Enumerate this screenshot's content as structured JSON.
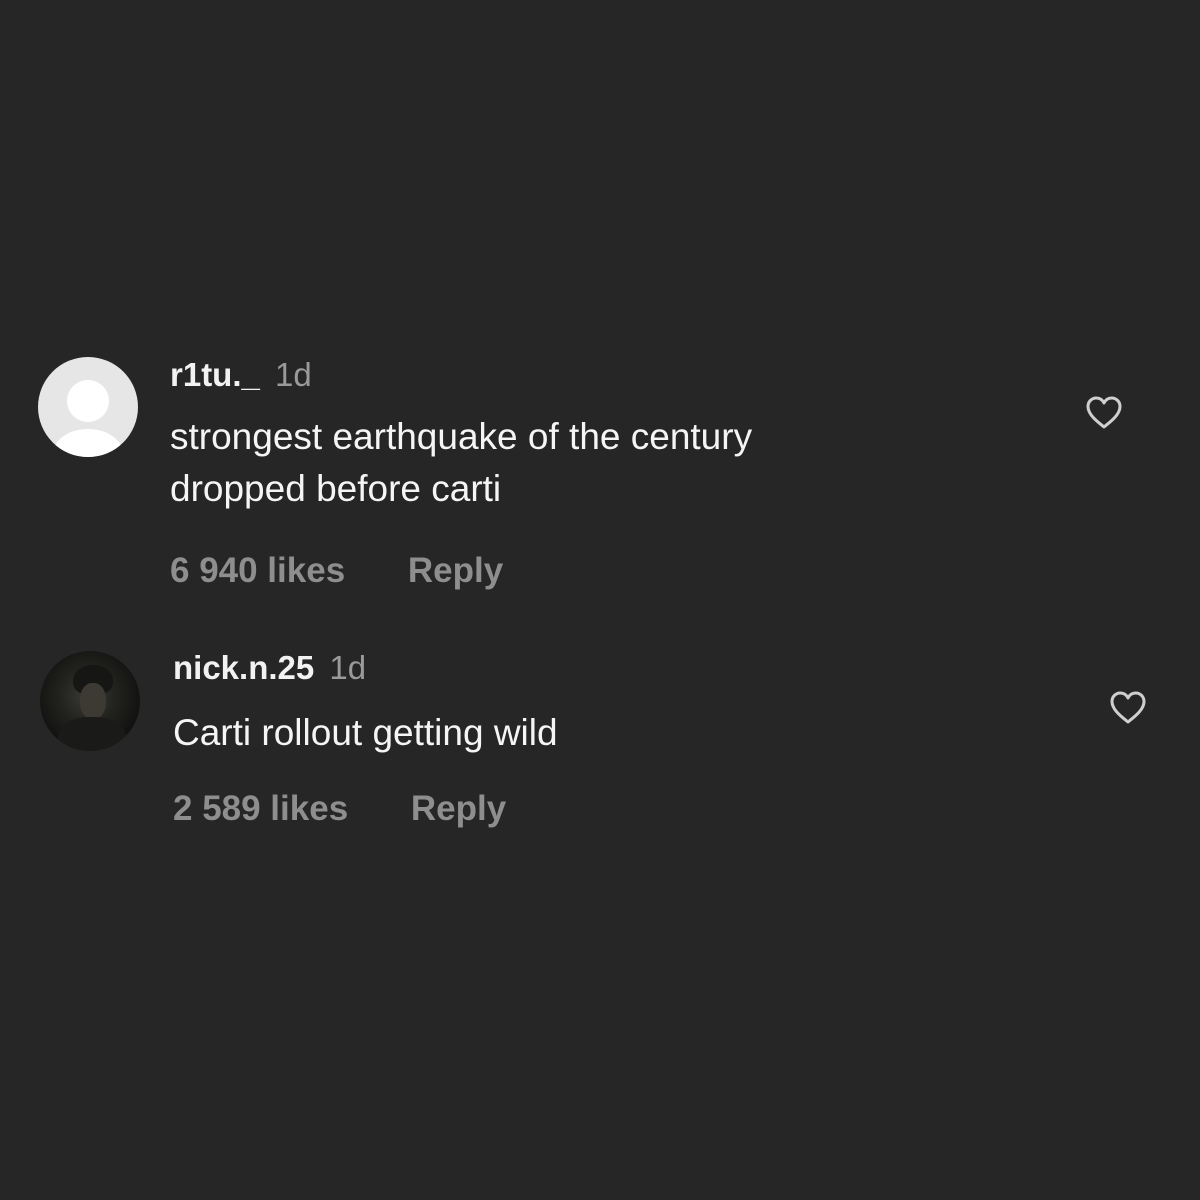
{
  "comments": [
    {
      "username": "r1tu._",
      "timestamp": "1d",
      "text_lines": [
        "strongest earthquake of the century",
        "dropped before carti"
      ],
      "likes": "6 940 likes",
      "reply_label": "Reply",
      "avatar": "default-avatar",
      "like_icon": "heart-outline-icon"
    },
    {
      "username": "nick.n.25",
      "timestamp": "1d",
      "text_lines": [
        "Carti rollout getting wild"
      ],
      "likes": "2 589 likes",
      "reply_label": "Reply",
      "avatar": "profile-photo",
      "like_icon": "heart-outline-icon"
    }
  ],
  "colors": {
    "background": "#262626",
    "username": "#f2f2f2",
    "timestamp": "#9a9a9a",
    "comment_text": "#f5f5f5",
    "actions": "#8e8e8e",
    "icon": "#cfcfcf"
  }
}
